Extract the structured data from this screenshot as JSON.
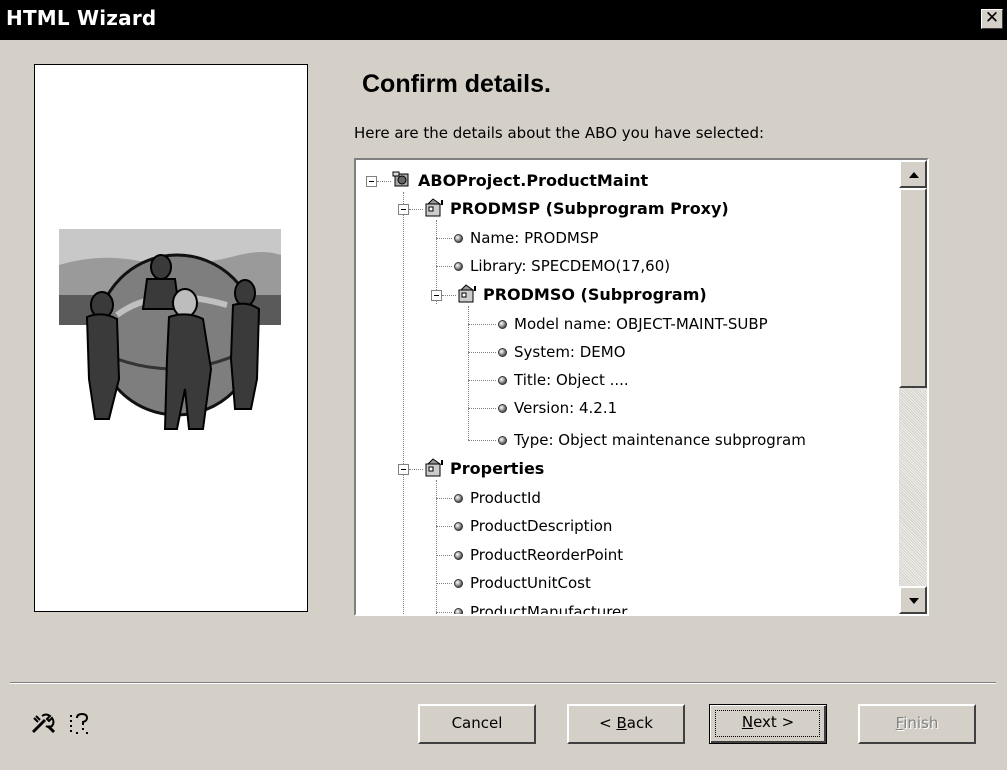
{
  "window": {
    "title": "HTML Wizard",
    "close_glyph": "✕"
  },
  "main": {
    "heading": "Confirm details.",
    "description": "Here are the details about the ABO you have selected:"
  },
  "tree": {
    "root": {
      "label": "ABOProject.ProductMaint",
      "icon": "project-icon"
    },
    "proxy": {
      "label": "PRODMSP (Subprogram Proxy)",
      "icon": "object-icon"
    },
    "proxy_items": [
      "Name: PRODMSP",
      "Library: SPECDEMO(17,60)"
    ],
    "subprogram": {
      "label": "PRODMSO (Subprogram)",
      "icon": "object-icon"
    },
    "subprogram_items": [
      "Model name: OBJECT-MAINT-SUBP",
      "System: DEMO",
      "Title: Object ....",
      "Version: 4.2.1",
      "Type: Object maintenance subprogram"
    ],
    "properties": {
      "label": "Properties",
      "icon": "object-icon"
    },
    "property_items": [
      "ProductId",
      "ProductDescription",
      "ProductReorderPoint",
      "ProductUnitCost",
      "ProductManufacturer"
    ]
  },
  "footer": {
    "tool_icons": [
      "tools-icon",
      "help-icon"
    ],
    "cancel_label": "Cancel",
    "back_prefix": "< ",
    "back_key": "B",
    "back_rest": "ack",
    "next_key": "N",
    "next_rest": "ext >",
    "finish_key": "F",
    "finish_rest": "inish"
  }
}
